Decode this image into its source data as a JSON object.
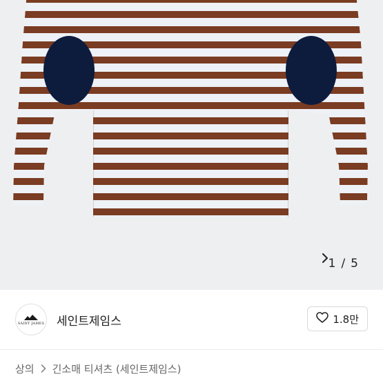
{
  "gallery": {
    "product_image": "striped-long-sleeve-tee-elbow-patches",
    "pager": {
      "current": "1",
      "separator": "/",
      "total": "5",
      "next_icon": "chevron-right-icon"
    },
    "colors": {
      "background": "#eeeff1",
      "stripe_light": "#eef1f6",
      "stripe_dark": "#7a3c22",
      "patch": "#0d1b3d"
    }
  },
  "brand": {
    "logo_text": "SAINT JAMES",
    "name": "세인트제임스",
    "like": {
      "icon": "heart-outline-icon",
      "count": "1.8만"
    }
  },
  "breadcrumb": {
    "items": [
      "상의",
      "긴소매 티셔츠 (세인트제임스)"
    ],
    "separator_icon": "chevron-right-icon"
  }
}
